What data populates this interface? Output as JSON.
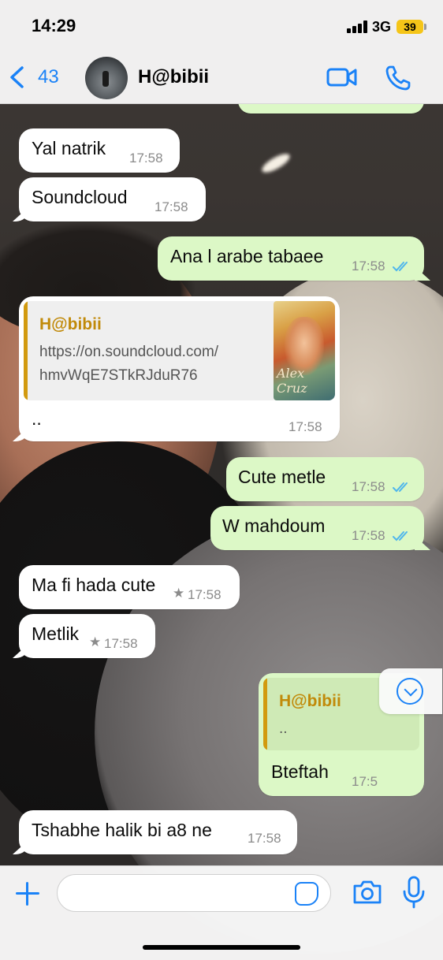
{
  "status_bar": {
    "time": "14:29",
    "network": "3G",
    "battery": "39"
  },
  "header": {
    "back_count": "43",
    "contact_name": "H@bibii",
    "icons": [
      "back-chevron-icon",
      "video-call-icon",
      "phone-call-icon"
    ]
  },
  "messages": [
    {
      "id": "m1",
      "direction": "in",
      "text": "Yal natrik",
      "time": "17:58"
    },
    {
      "id": "m2",
      "direction": "in",
      "text": "Soundcloud",
      "time": "17:58"
    },
    {
      "id": "m3",
      "direction": "out",
      "text": "Ana l arabe tabaee",
      "time": "17:58",
      "read": true
    },
    {
      "id": "m4",
      "direction": "in",
      "quote_name": "H@bibii",
      "quote_line1": "https://on.soundcloud.com/",
      "quote_line2": "hmvWqE7STkRJduR76",
      "thumb_signature": "Alex Cruz",
      "text": "..",
      "time": "17:58"
    },
    {
      "id": "m5",
      "direction": "out",
      "text": "Cute metle",
      "time": "17:58",
      "read": true
    },
    {
      "id": "m6",
      "direction": "out",
      "text": "W mahdoum",
      "time": "17:58",
      "read": true
    },
    {
      "id": "m7",
      "direction": "in",
      "text": "Ma fi hada cute",
      "time": "17:58",
      "starred": true
    },
    {
      "id": "m8",
      "direction": "in",
      "text": "Metlik",
      "time": "17:58",
      "starred": true
    },
    {
      "id": "m9",
      "direction": "out",
      "quote_name": "H@bibii",
      "quote_text": "..",
      "text": "Bteftah",
      "time": "17:5"
    },
    {
      "id": "m10",
      "direction": "in",
      "text": "Tshabhe halik bi a8 ne",
      "time": "17:58"
    }
  ],
  "input_bar": {
    "placeholder": "",
    "icons": [
      "plus-icon",
      "sticker-icon",
      "camera-icon",
      "microphone-icon"
    ]
  },
  "colors": {
    "accent": "#1a82f7",
    "outgoing_bubble": "#dcf8c6",
    "incoming_bubble": "#ffffff",
    "read_ticks": "#4fb6ec",
    "quote_name": "#c18a0a"
  }
}
